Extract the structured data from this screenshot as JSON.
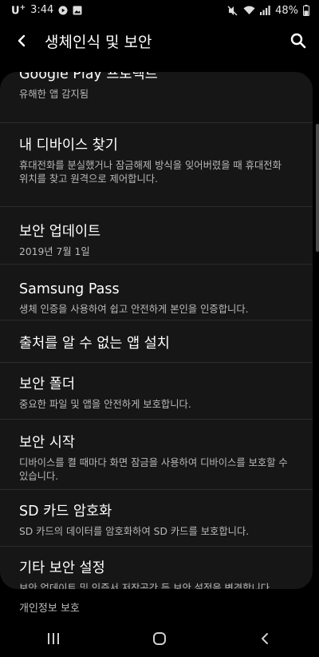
{
  "status_bar": {
    "carrier": "U",
    "carrier_super": "+",
    "time": "3:44",
    "battery": "48%"
  },
  "app_bar": {
    "title": "생체인식 및 보안"
  },
  "items": [
    {
      "title": "Google Play 프로텍트",
      "subtitle": "유해한 앱 감지됨"
    },
    {
      "title": "내 디바이스 찾기",
      "subtitle": "휴대전화를 분실했거나 잠금해제 방식을 잊어버렸을 때 휴대전화 위치를 찾고 원격으로 제어합니다."
    },
    {
      "title": "보안 업데이트",
      "subtitle": "2019년 7월 1일"
    },
    {
      "title": "Samsung Pass",
      "subtitle": "생체 인증을 사용하여 쉽고 안전하게 본인을 인증합니다."
    },
    {
      "title": "출처를 알 수 없는 앱 설치",
      "subtitle": ""
    },
    {
      "title": "보안 폴더",
      "subtitle": "중요한 파일 및 앱을 안전하게 보호합니다."
    },
    {
      "title": "보안 시작",
      "subtitle": "디바이스를 켤 때마다 화면 잠금을 사용하여 디바이스를 보호할 수 있습니다."
    },
    {
      "title": "SD 카드 암호화",
      "subtitle": "SD 카드의 데이터를 암호화하여 SD 카드를 보호합니다."
    },
    {
      "title": "기타 보안 설정",
      "subtitle": "보안 업데이트 및 인증서 저장공간 등 보안 설정을 변경합니다."
    }
  ],
  "section_header": "개인정보 보호"
}
